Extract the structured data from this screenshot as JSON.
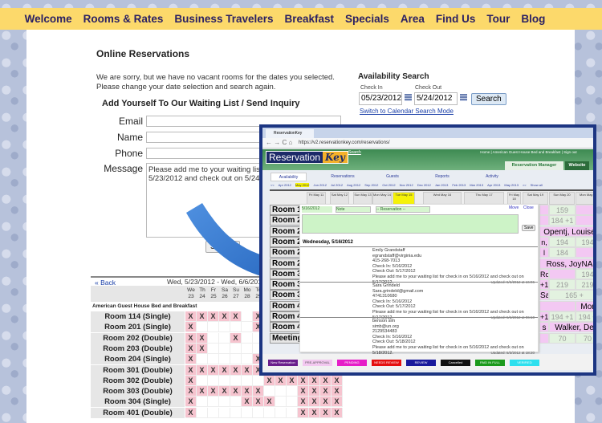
{
  "nav": [
    "Welcome",
    "Rooms & Rates",
    "Business Travelers",
    "Breakfast",
    "Specials",
    "Area",
    "Find Us",
    "Tour",
    "Blog"
  ],
  "main": {
    "title": "Online Reservations",
    "notice": "We are sorry, but we have no vacant rooms for the dates you selected. Please change your date selection and search again.",
    "waitlist_title": "Add Yourself To Our Waiting List / Send Inquiry",
    "fields": {
      "email": "Email",
      "name": "Name",
      "phone": "Phone",
      "message": "Message"
    },
    "message_value": "Please add me to your waiting list for check in on 5/23/2012 and check out on 5/24/2012.",
    "submit": "Submit"
  },
  "search": {
    "title": "Availability Search",
    "checkin_label": "Check In",
    "checkin": "05/23/2012",
    "checkout_label": "Check Out",
    "checkout": "5/24/2012",
    "button": "Search",
    "switch_link": "Switch to Calendar Search Mode"
  },
  "availability": {
    "back": "« Back",
    "range": "Wed, 5/23/2012 - Wed, 6/6/2012",
    "days": [
      [
        "We",
        "23"
      ],
      [
        "Th",
        "24"
      ],
      [
        "Fr",
        "25"
      ],
      [
        "Sa",
        "26"
      ],
      [
        "Su",
        "27"
      ],
      [
        "Mo",
        "28"
      ],
      [
        "Tu",
        "29"
      ]
    ],
    "property": "American Guest House Bed and Breakfast",
    "rooms": [
      {
        "name": "Room 114 (Single)",
        "booked": [
          0,
          1,
          2,
          3,
          4,
          6
        ]
      },
      {
        "name": "Room 201 (Single)",
        "booked": [
          0,
          6
        ]
      },
      {
        "name": "Room 202 (Double)",
        "booked": [
          0,
          1,
          4
        ]
      },
      {
        "name": "Room 203 (Double)",
        "booked": [
          0,
          1
        ]
      },
      {
        "name": "Room 204 (Single)",
        "booked": [
          0,
          6
        ]
      },
      {
        "name": "Room 301 (Double)",
        "booked": [
          0,
          1,
          2,
          3,
          4,
          5,
          6
        ]
      },
      {
        "name": "Room 302 (Double)",
        "booked": [
          0,
          7,
          8,
          9,
          10,
          11,
          12,
          13
        ]
      },
      {
        "name": "Room 303 (Double)",
        "booked": [
          0,
          1,
          2,
          3,
          4,
          5,
          6,
          10,
          11,
          12,
          13
        ]
      },
      {
        "name": "Room 304 (Single)",
        "booked": [
          0,
          5,
          6,
          7,
          10,
          11,
          12,
          13
        ]
      },
      {
        "name": "Room 401 (Double)",
        "booked": [
          0,
          10,
          11,
          12,
          13
        ]
      }
    ],
    "mark": "X"
  },
  "rk": {
    "tab_title": "ReservationKey",
    "url": "https://v2.reservationkey.com/reservations/",
    "logo_a": "Reservation",
    "logo_b": "Key",
    "search_link": "Search",
    "top_links": " Home | American Guest House Bed and Breakfast | Sign out",
    "manager_tab": "Reservation Manager",
    "website_tab": "Website",
    "tabs": [
      "Availability",
      "Reservations",
      "Guests",
      "Reports",
      "Activity"
    ],
    "months": [
      "<<",
      "Apr 2012",
      "May 2012",
      "Jun 2012",
      "Jul 2012",
      "Aug 2012",
      "Sep 2012",
      "Oct 2012",
      "Nov 2012",
      "Dec 2012",
      "Jan 2013",
      "Feb 2013",
      "Mar 2013",
      "Apr 2013",
      "May 2013",
      ">>",
      "Show all"
    ],
    "day_headers": [
      "Fri May 11",
      "Sat May 12",
      "Sun May 13",
      "Mon May 14",
      "Tue May 15",
      "Wed May 16",
      "Thu May 17",
      "Fri May 18",
      "Sat May 19",
      "Sun May 20",
      "Mon May 21"
    ],
    "room_labels": [
      "Room 114",
      "Room 201",
      "Room 202",
      "Room 203",
      "Room 204",
      "Room 205",
      "Room 301",
      "Room 302",
      "Room 303",
      "Room 401",
      "Room 402",
      "Room 403",
      "Meeting"
    ],
    "right_cells": [
      [
        "",
        "159",
        ""
      ],
      [
        "",
        "184 +1",
        ""
      ],
      [
        "Opentj, Louise"
      ],
      [
        "n,",
        "194",
        "194"
      ],
      [
        "l",
        "184",
        ""
      ],
      [
        "Ross, JoyNA"
      ],
      [
        "Rosali",
        "",
        "194"
      ],
      [
        "+1",
        "219",
        "219"
      ],
      [
        "Sara",
        "165 +"
      ],
      [
        "",
        "Mor"
      ],
      [
        "+1",
        "194 +1",
        "194 +"
      ],
      [
        "s",
        "Walker, De"
      ],
      [
        "",
        "70",
        "70"
      ]
    ],
    "popup": {
      "date": "5/16/2012",
      "note": "Note",
      "reservation": "-- Reservation --",
      "move": "Move",
      "close": "Close",
      "save": "Save",
      "day": "Wednesday, 5/16/2012",
      "entries": [
        {
          "lines": [
            "Emily Grandstaff",
            "egrandstaff@virginia.edu",
            "415-268-7013",
            "Check In: 5/16/2012",
            "Check Out: 5/17/2012",
            "Please add me to your waiting list for check in on 5/16/2012 and check out on 5/17/2012."
          ],
          "updated": "Updated: 5/6/2012 at 16:06"
        },
        {
          "lines": [
            "Sara Grindeld",
            "Sara.grindeld@gmail.com",
            "4741310680",
            "Check In: 5/16/2012",
            "Check Out: 5/17/2012",
            "Please add me to your waiting list for check in on 5/16/2012 and check out on 5/17/2012."
          ],
          "updated": "Updated: 5/6/2012 at 06:10"
        },
        {
          "lines": [
            "benson sim",
            "simb@un.org",
            "2129534483",
            "Check In: 5/16/2012",
            "Check Out: 5/18/2012",
            "Please add me to your waiting list for check in on 5/16/2012 and check out on 5/18/2012."
          ],
          "updated": "Updated: 5/3/2012 at 18:20"
        }
      ]
    },
    "legend": [
      {
        "label": "New Reservation",
        "color": "#6b1f8c"
      },
      {
        "label": "PRE-APPROVAL",
        "color": "#f3c8f0"
      },
      {
        "label": "PENDING",
        "color": "#e61ec8"
      },
      {
        "label": "NEEDS REVIEW",
        "color": "#e51010"
      },
      {
        "label": "REVIEW",
        "color": "#1a1a9c"
      },
      {
        "label": "Cancelled",
        "color": "#111111"
      },
      {
        "label": "PAID IN FULL",
        "color": "#1c9a1c"
      },
      {
        "label": "VERIFIED",
        "color": "#2ee0ee"
      }
    ]
  },
  "colors": {
    "nav": "#fcd96b",
    "booked": "#f6c4cf",
    "frame": "#1c3582",
    "arrow": "#2f73cc"
  }
}
